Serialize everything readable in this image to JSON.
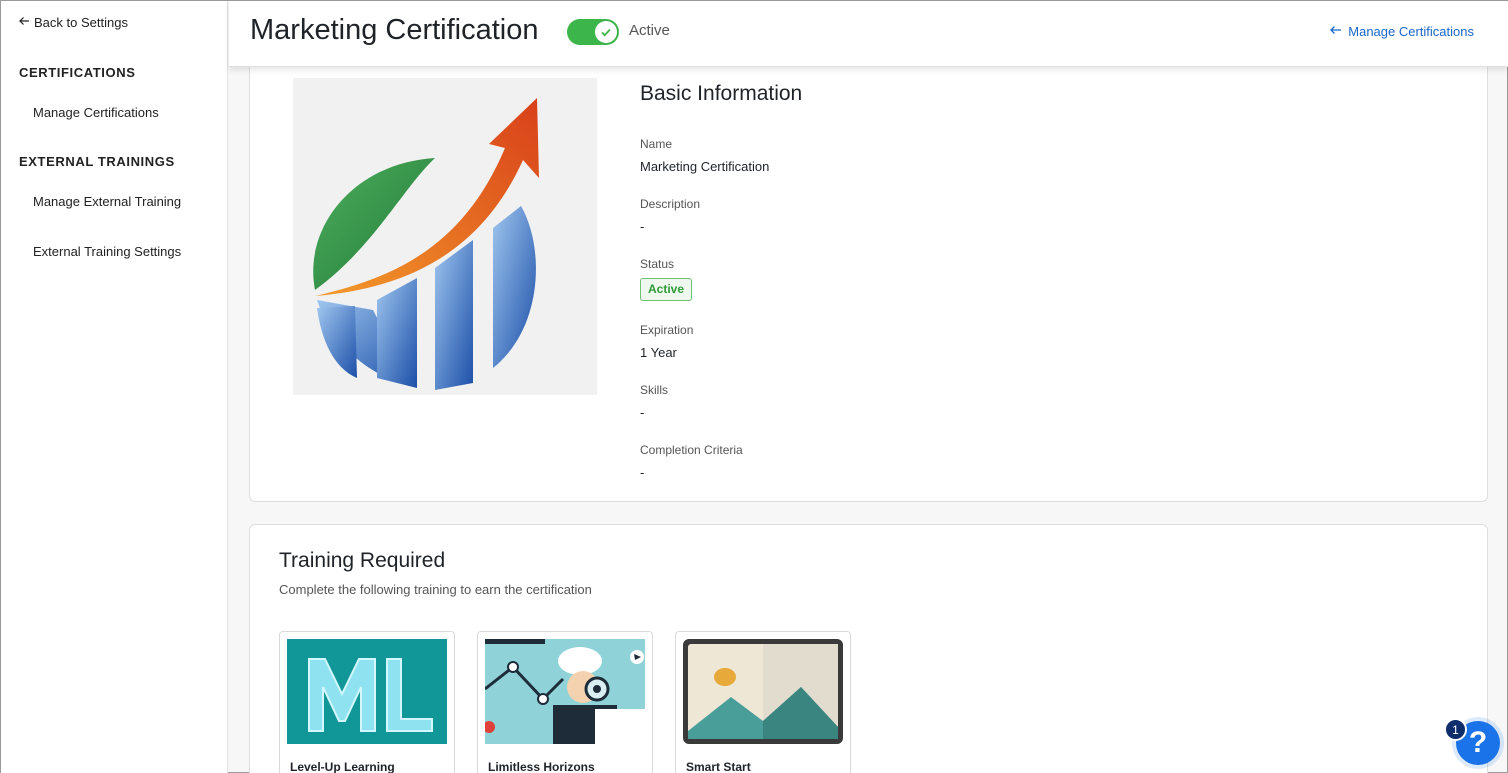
{
  "sidebar": {
    "back_label": "Back to Settings",
    "sections": [
      {
        "title": "CERTIFICATIONS",
        "items": [
          "Manage Certifications"
        ]
      },
      {
        "title": "EXTERNAL TRAININGS",
        "items": [
          "Manage External Training",
          "External Training Settings"
        ]
      }
    ]
  },
  "header": {
    "title": "Marketing Certification",
    "toggle_label": "Active",
    "toggle_on": true,
    "manage_link": "Manage Certifications"
  },
  "basic": {
    "title": "Basic Information",
    "fields": {
      "name_label": "Name",
      "name_value": "Marketing Certification",
      "description_label": "Description",
      "description_value": "-",
      "status_label": "Status",
      "status_value": "Active",
      "expiration_label": "Expiration",
      "expiration_value": "1 Year",
      "skills_label": "Skills",
      "skills_value": "-",
      "criteria_label": "Completion Criteria",
      "criteria_value": "-"
    }
  },
  "training": {
    "title": "Training Required",
    "subtitle": "Complete the following training to earn the certification",
    "items": [
      {
        "name": "Level-Up Learning"
      },
      {
        "name": "Limitless Horizons"
      },
      {
        "name": "Smart Start"
      }
    ]
  },
  "help": {
    "count": "1",
    "label": "?"
  },
  "colors": {
    "accent": "#1a73e8",
    "active_green": "#3cb54a",
    "link_blue": "#1a66c9"
  }
}
